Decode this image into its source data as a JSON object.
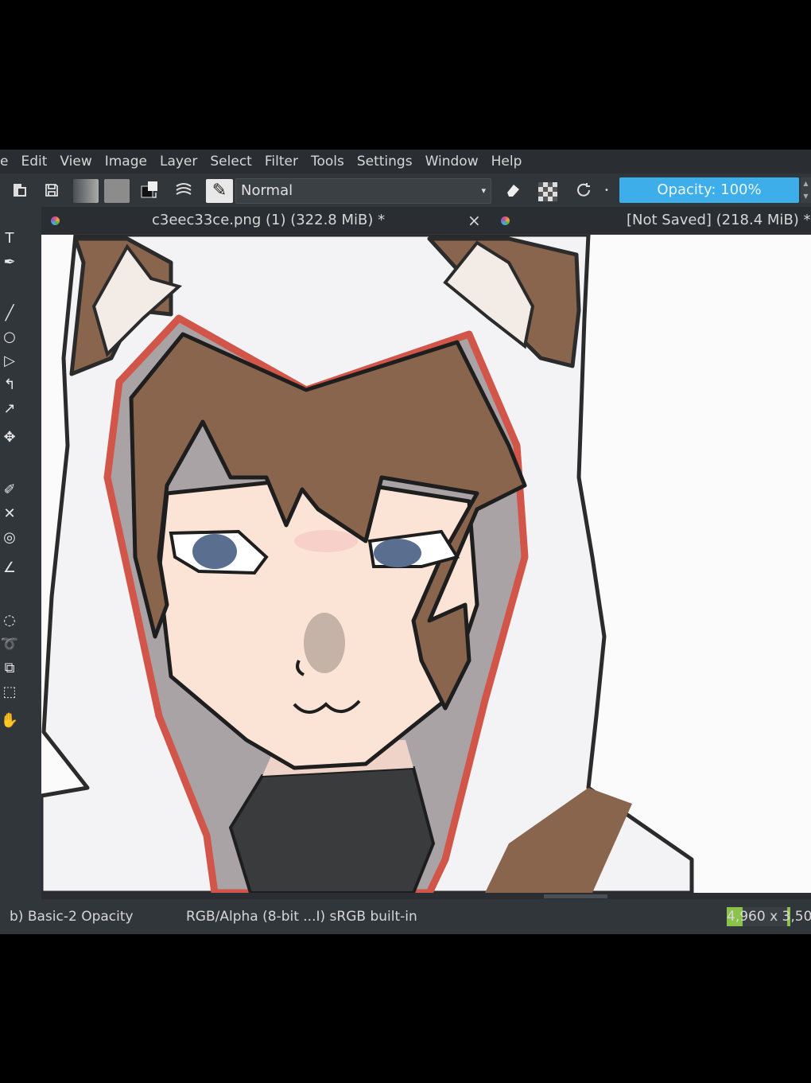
{
  "menubar": {
    "items": [
      "e",
      "Edit",
      "View",
      "Image",
      "Layer",
      "Select",
      "Filter",
      "Tools",
      "Settings",
      "Window",
      "Help"
    ]
  },
  "toolbar": {
    "blend_mode": "Normal",
    "opacity_label": "Opacity: 100%",
    "icons": [
      "new-document-icon",
      "save-icon",
      "gradient-swatch",
      "pattern-swatch",
      "color-swap-icon",
      "brush-settings-icon",
      "brush-preset-icon",
      "eraser-icon",
      "alpha-lock-icon",
      "reload-preset-icon"
    ]
  },
  "tabs": [
    {
      "label": "c3eec33ce.png (1) (322.8 MiB) *",
      "close": "×"
    },
    {
      "label": "[Not Saved]  (218.4 MiB) *"
    }
  ],
  "toolbox": {
    "tools": [
      "text-tool-icon",
      "calligraphy-tool-icon",
      "line-tool-icon",
      "ellipse-tool-icon",
      "polygon-tool-icon",
      "polyline-tool-icon",
      "bezier-tool-icon",
      "move-tool-icon",
      "color-picker-icon",
      "assistant-tool-icon",
      "smart-patch-icon",
      "measure-tool-icon",
      "elliptical-select-icon",
      "freehand-select-icon",
      "magnetic-select-icon",
      "bezier-select-icon",
      "pan-tool-icon"
    ]
  },
  "statusbar": {
    "brush": "b) Basic-2 Opacity",
    "color_space": "RGB/Alpha (8-bit ...I)  sRGB built-in",
    "dimensions": "4,960 x 3,50"
  },
  "colors": {
    "accent": "#3daee9",
    "panel": "#31363b",
    "hood_outline": "#d2554a",
    "hair": "#7a5a44",
    "eyes": "#5a6f8f"
  }
}
